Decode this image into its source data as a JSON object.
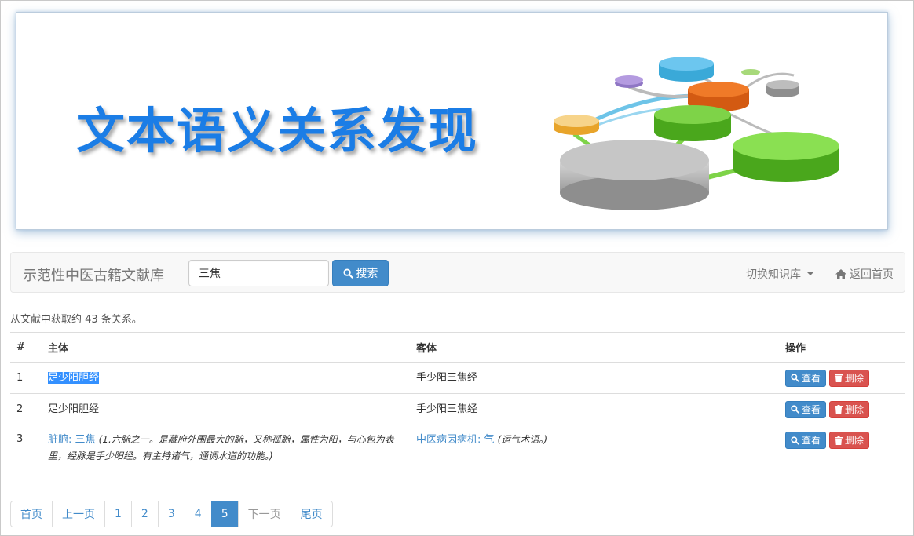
{
  "banner": {
    "title": "文本语义关系发现"
  },
  "navbar": {
    "brand": "示范性中医古籍文献库",
    "search_value": "三焦",
    "search_button": "搜索",
    "switch_kb": "切换知识库",
    "home": "返回首页"
  },
  "summary": "从文献中获取约 43 条关系。",
  "table": {
    "headers": [
      "#",
      "主体",
      "客体",
      "操作"
    ],
    "rows": [
      {
        "num": "1",
        "subject": "足少阳胆经",
        "object": "手少阳三焦经"
      },
      {
        "num": "2",
        "subject": "足少阳胆经",
        "object": "手少阳三焦经"
      },
      {
        "num": "3",
        "subject_link": "脏腑: 三焦",
        "subject_note": "(1.六腑之一。是藏府外围最大的腑，又称孤腑，属性为阳，与心包为表里，经脉是手少阳经。有主持诸气，通调水道的功能。)",
        "object_link": "中医病因病机: 气",
        "object_note": "(运气术语。)"
      }
    ],
    "view_label": "查看",
    "delete_label": "删除"
  },
  "pagination": {
    "first": "首页",
    "prev": "上一页",
    "pages": [
      "1",
      "2",
      "3",
      "4",
      "5"
    ],
    "active": "5",
    "next": "下一页",
    "last": "尾页"
  },
  "colors": {
    "primary": "#428bca",
    "danger": "#d9534f",
    "banner_title": "#1b7de6"
  }
}
